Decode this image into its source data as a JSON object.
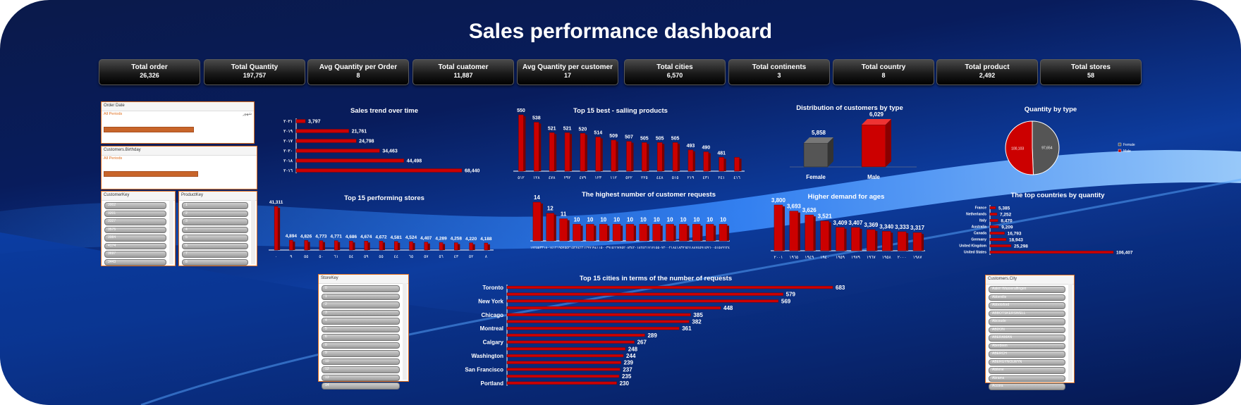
{
  "title": "Sales performance dashboard",
  "kpis": [
    {
      "label": "Total order",
      "value": "26,326"
    },
    {
      "label": "Total Quantity",
      "value": "197,757"
    },
    {
      "label": "Avg Quantity per Order",
      "value": "8"
    },
    {
      "label": "Total cuatomer",
      "value": "11,887"
    },
    {
      "label": "Avg  Quantity per customer",
      "value": "17"
    },
    {
      "label": "Total cities",
      "value": "6,570"
    },
    {
      "label": "Total continents",
      "value": "3"
    },
    {
      "label": "Total country",
      "value": "8"
    },
    {
      "label": "Total product",
      "value": "2,492"
    },
    {
      "label": "Total stores",
      "value": "58"
    }
  ],
  "slicers": {
    "order_date": {
      "header": "Order Date",
      "sub": "All Periods",
      "right": "شهور"
    },
    "customers_birthday": {
      "header": "Customers.Birthday",
      "sub": "All Periods"
    },
    "customer_key": {
      "header": "CustomerKey",
      "items": [
        "3002",
        "3201",
        "3327",
        "3575",
        "3984",
        "4174",
        "3697",
        "3443"
      ]
    },
    "product_key": {
      "header": "ProductKey",
      "items": [
        "1",
        "2",
        "3",
        "4",
        "5",
        "6",
        "7",
        "8"
      ]
    },
    "store_key": {
      "header": "StoreKey",
      "items": [
        "0",
        "1",
        "2",
        "3",
        "4",
        "5",
        "6",
        "8",
        "9",
        "10",
        "12",
        "13",
        "14"
      ]
    },
    "customers_city": {
      "header": "Customers.City",
      "items": [
        "Aalen Wasseralfingen",
        "Abbeville",
        "Abbotsford",
        "ABBOTSKERSWELL",
        "Abcoude",
        "ABDON",
        "ABERAMAN",
        "Aberdeen",
        "ABERCH",
        "ABERGYNOLWYN",
        "Abilene",
        "Abrams",
        "Accora"
      ]
    }
  },
  "chart_data": [
    {
      "id": "sales_trend",
      "type": "bar",
      "orientation": "horizontal",
      "title": "Sales trend over time",
      "categories": [
        "٢٠٢١",
        "٢٠١٩",
        "٢٠١٧",
        "٢٠٢٠",
        "٢٠١٨",
        "٢٠١٦"
      ],
      "values": [
        3797,
        21761,
        24798,
        34463,
        44498,
        68440
      ],
      "labels": [
        "3,797",
        "21,761",
        "24,798",
        "34,463",
        "44,498",
        "68,440"
      ]
    },
    {
      "id": "top15_products",
      "type": "bar",
      "title": "Top 15 best - salling products",
      "categories": [
        "٥١٢",
        "١٢٨",
        "٤٧٨",
        "٢٩٢",
        "٤٧٩",
        "١٢٣",
        "١١٢",
        "٥٢٢",
        "٢٢٥",
        "٤٤٨",
        "٥١٥",
        "٢١٩",
        "٤٣١",
        "٢٤١",
        "٤١٦"
      ],
      "values": [
        550,
        538,
        521,
        521,
        520,
        514,
        509,
        507,
        505,
        505,
        505,
        493,
        490,
        481,
        481
      ],
      "labels": [
        "550",
        "538",
        "521",
        "521",
        "520",
        "514",
        "509",
        "507",
        "505",
        "505",
        "505",
        "493",
        "490",
        "481",
        ""
      ]
    },
    {
      "id": "customer_types",
      "type": "bar",
      "title": "Distribution of customers by type",
      "categories": [
        "Female",
        "Male"
      ],
      "values": [
        5858,
        6029
      ],
      "labels": [
        "5,858",
        "6,029"
      ],
      "colors": [
        "#555555",
        "#cc0000"
      ]
    },
    {
      "id": "quantity_by_type",
      "type": "pie",
      "title": "Quantity by type",
      "categories": [
        "Female",
        "Male"
      ],
      "values": [
        97654,
        100103
      ],
      "labels": [
        "97,654",
        "100,103"
      ],
      "colors": [
        "#555555",
        "#cc0000"
      ],
      "legend": "right"
    },
    {
      "id": "top15_stores",
      "type": "bar",
      "title": "Top 15 performing stores",
      "categories": [
        "٠",
        "٩",
        "٥٥",
        "٥٠",
        "٦١",
        "٥٤",
        "٥٩",
        "٥٥",
        "٤٤",
        "٦٥",
        "٥٧",
        "٥٦",
        "٤٣",
        "٥٢",
        "٨"
      ],
      "values": [
        41311,
        4894,
        4826,
        4773,
        4771,
        4686,
        4674,
        4672,
        4581,
        4524,
        4407,
        4289,
        4258,
        4220,
        4188
      ],
      "labels": [
        "41,311",
        "4,894",
        "4,826",
        "4,773",
        "4,771",
        "4,686",
        "4,674",
        "4,672",
        "4,581",
        "4,524",
        "4,407",
        "4,289",
        "4,258",
        "4,220",
        "4,188"
      ]
    },
    {
      "id": "customer_requests",
      "type": "bar",
      "title": "The highest number of customer requests",
      "categories": [
        "١٧٢٥٥٣٣",
        "١٨٠١٤١٢",
        "١٩٥٧٥٥٢",
        "١٥٢٧٤٢٢",
        "١٢٩٩٦٩٤",
        "١١٥٠٠٣٩",
        "١٥٦٦٧٧٥",
        "٢٠٨٣٤٢٠",
        "١٨٢٤٢١٧",
        "١٧١٥٥٠٧",
        "٢٠٠٢١٨٤",
        "١٨٣٧٦٥٦",
        "١٨٨٧٤٥٩",
        "١٥٩٦٠٠٥",
        "١٥٨٩٦٢٤"
      ],
      "values": [
        14,
        12,
        11,
        10,
        10,
        10,
        10,
        10,
        10,
        10,
        10,
        10,
        10,
        10,
        10
      ],
      "labels": [
        "14",
        "12",
        "11",
        "10",
        "10",
        "10",
        "10",
        "10",
        "10",
        "10",
        "10",
        "10",
        "10",
        "10",
        "10"
      ]
    },
    {
      "id": "demand_by_age",
      "type": "bar",
      "title": "Higher demand for ages",
      "categories": [
        "٢٠٠١",
        "١٩٦٥",
        "١٩٤٩",
        "١٩٤٠",
        "١٩٥٩",
        "١٩٧٩",
        "١٩٦٧",
        "١٩٥٨",
        "٢٠٠٠",
        "١٩٨٧"
      ],
      "values": [
        3800,
        3693,
        3626,
        3521,
        3409,
        3407,
        3369,
        3340,
        3333,
        3317
      ],
      "labels": [
        "3,800",
        "3,693",
        "3,626",
        "3,521",
        "3,409",
        "3,407",
        "3,369",
        "3,340",
        "3,333",
        "3,317"
      ]
    },
    {
      "id": "top_countries",
      "type": "bar",
      "orientation": "horizontal",
      "title": "The top countries by quantity",
      "categories": [
        "France",
        "Netherlands",
        "Italy",
        "Australia",
        "Canada",
        "Germany",
        "United Kingdom",
        "United States"
      ],
      "values": [
        5385,
        7252,
        8470,
        9209,
        16793,
        18943,
        25298,
        106407
      ],
      "labels": [
        "5,385",
        "7,252",
        "8,470",
        "9,209",
        "16,793",
        "18,943",
        "25,298",
        "106,407"
      ]
    },
    {
      "id": "top15_cities",
      "type": "bar",
      "orientation": "horizontal",
      "title": "Top 15 cities in terms of the number of requests",
      "categories": [
        "Toronto",
        "",
        "New York",
        "",
        "Chicago",
        "",
        "Montreal",
        "",
        "Calgary",
        "",
        "Washington",
        "",
        "San Francisco",
        "",
        "Portland"
      ],
      "values": [
        683,
        579,
        569,
        448,
        385,
        382,
        361,
        289,
        267,
        248,
        244,
        239,
        237,
        235,
        230
      ],
      "labels": [
        "683",
        "579",
        "569",
        "448",
        "385",
        "382",
        "361",
        "289",
        "267",
        "248",
        "244",
        "239",
        "237",
        "235",
        "230"
      ]
    }
  ]
}
